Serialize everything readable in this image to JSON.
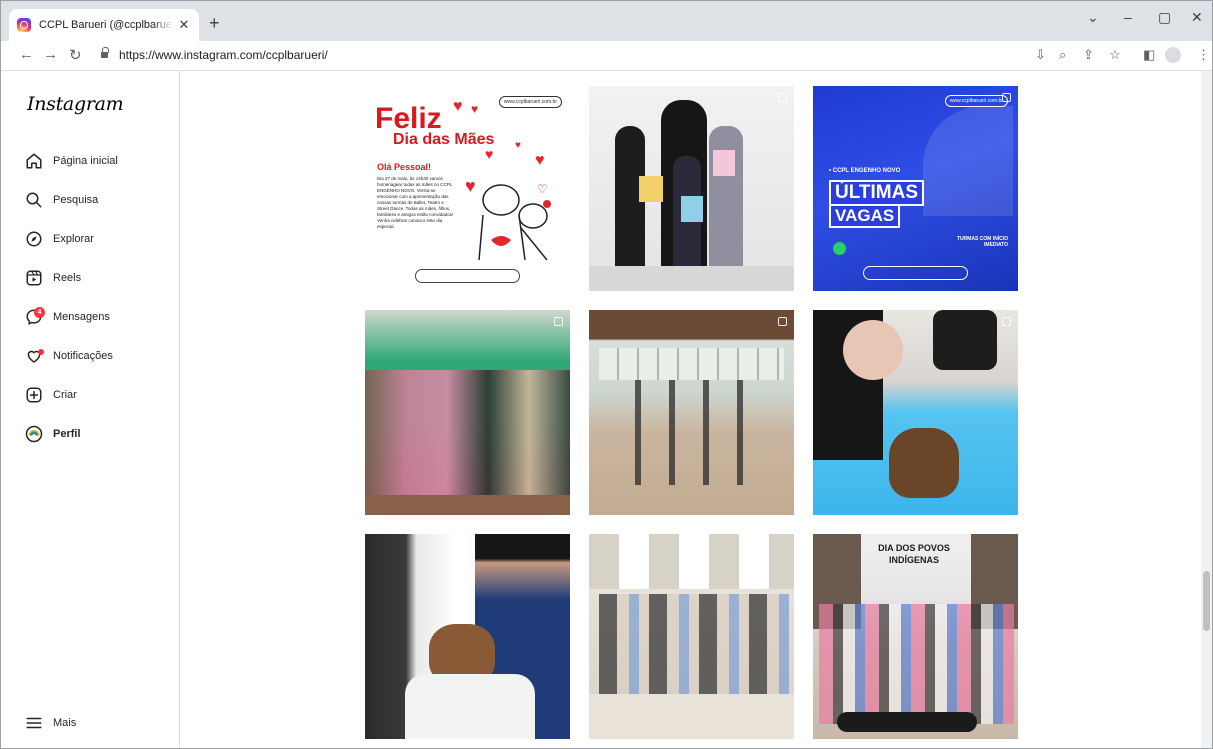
{
  "browser": {
    "tab_title": "CCPL Barueri (@ccplbarueri) • Fo",
    "new_tab": "+",
    "close_tab": "✕",
    "url": "https://www.instagram.com/ccplbarueri/",
    "win_min": "–",
    "win_max": "▢",
    "win_close": "✕",
    "win_down": "⌄"
  },
  "sidebar": {
    "logo": "Instagram",
    "items": [
      {
        "label": "Página inicial",
        "icon": "home-icon"
      },
      {
        "label": "Pesquisa",
        "icon": "search-icon"
      },
      {
        "label": "Explorar",
        "icon": "compass-icon"
      },
      {
        "label": "Reels",
        "icon": "reels-icon"
      },
      {
        "label": "Mensagens",
        "icon": "messenger-icon",
        "badge": "4"
      },
      {
        "label": "Notificações",
        "icon": "heart-icon"
      },
      {
        "label": "Criar",
        "icon": "create-icon"
      },
      {
        "label": "Perfil",
        "icon": "profile-avatar"
      }
    ],
    "more": "Mais"
  },
  "posts": {
    "p1": {
      "brand": "www.ccplbarueri.com.br",
      "title1": "Feliz",
      "title2": "Dia das Mães",
      "greeting": "Olá Pessoal!",
      "body": "Dia 27 de maio, às 14h30 vamos homenagear todas as mães no CCPL ENGENHO NOVO. Venha se emocionar com a apresentação das nossas turmas de Ballet, Teatro e Street Dance. Todas as mães, filhos, familiares e amigos estão convidados! Venha celebrar conosco este dia especial."
    },
    "p3": {
      "brand": "www.ccplbarueri.com.br",
      "sub": "• CCPL ENGENHO NOVO",
      "line1": "ÚLTIMAS",
      "line2": "VAGAS",
      "turmas": "TURMAS COM INÍCIO IMEDIATO"
    },
    "p9": {
      "banner": "DIA DOS POVOS INDÍGENAS"
    }
  }
}
